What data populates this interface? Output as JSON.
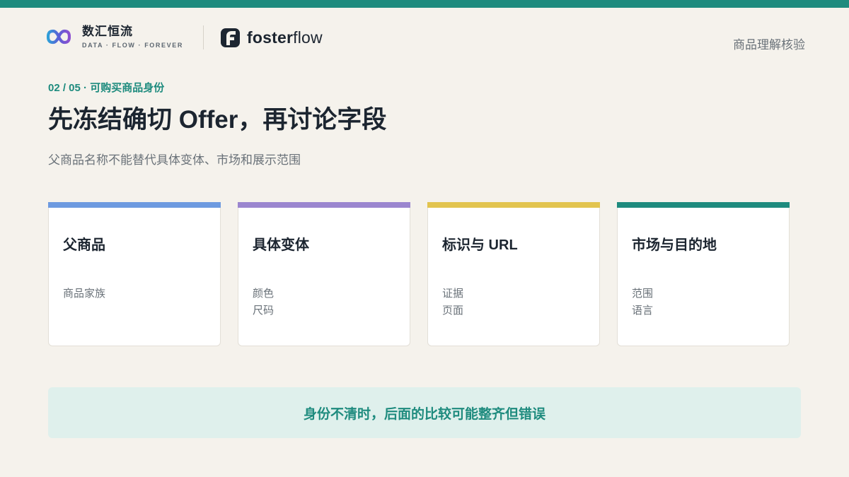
{
  "brand": {
    "name": "数汇恒流",
    "tagline": "DATA · FLOW · FOREVER",
    "logo_icon": "infinity-logo-icon"
  },
  "partner": {
    "name_bold": "foster",
    "name_light": "flow",
    "logo_icon": "fosterflow-logo-icon"
  },
  "header": {
    "section_label": "商品理解核验"
  },
  "slide": {
    "eyebrow": "02 / 05 · 可购买商品身份",
    "headline": "先冻结确切 Offer，再讨论字段",
    "subtitle": "父商品名称不能替代具体变体、市场和展示范围"
  },
  "cards": [
    {
      "title": "父商品",
      "items": [
        "商品家族"
      ],
      "accent": "#6d9ae0"
    },
    {
      "title": "具体变体",
      "items": [
        "颜色",
        "尺码"
      ],
      "accent": "#9b86cf"
    },
    {
      "title": "标识与 URL",
      "items": [
        "证据",
        "页面"
      ],
      "accent": "#e2c44f"
    },
    {
      "title": "市场与目的地",
      "items": [
        "范围",
        "语言"
      ],
      "accent": "#1e8b7e"
    }
  ],
  "callout": {
    "text": "身份不清时，后面的比较可能整齐但错误"
  },
  "colors": {
    "accent": "#1e8b7e",
    "background": "#f5f2ec",
    "callout_bg": "#dff0ec"
  }
}
